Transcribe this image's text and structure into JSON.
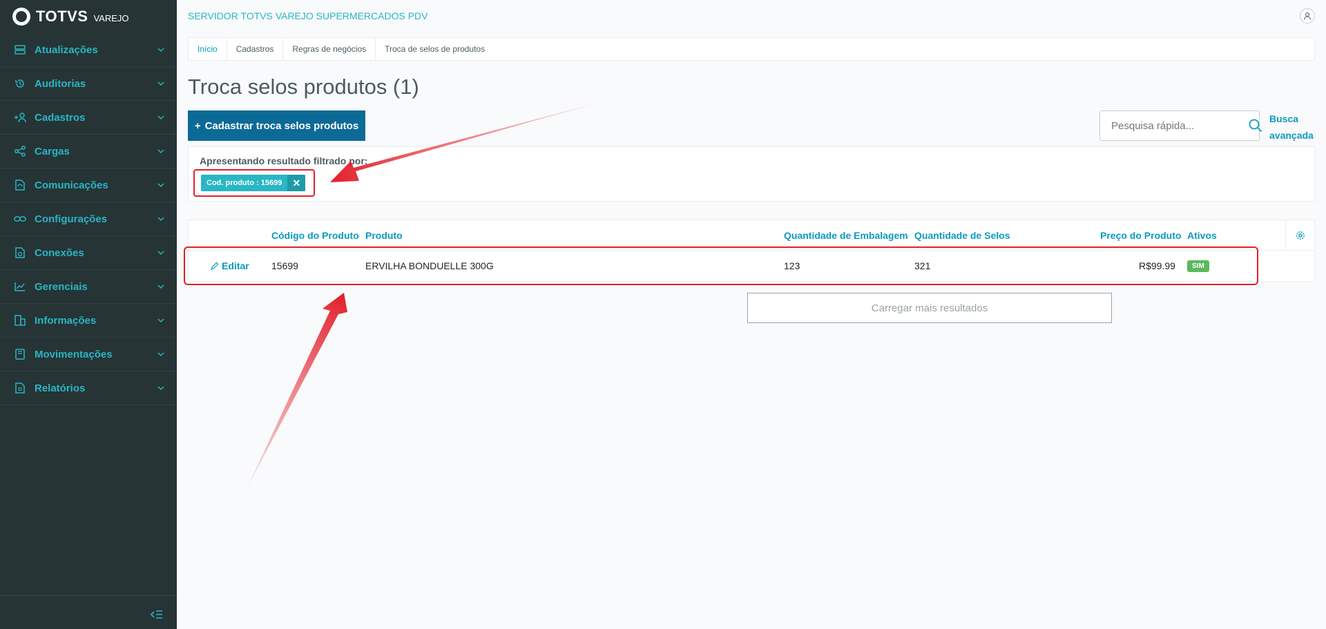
{
  "sidebar": {
    "logo": {
      "name": "TOTVS",
      "sub": "VAREJO"
    },
    "items": [
      {
        "label": "Atualizações",
        "icon": "server-icon"
      },
      {
        "label": "Auditorias",
        "icon": "history-icon"
      },
      {
        "label": "Cadastros",
        "icon": "add-user-icon"
      },
      {
        "label": "Cargas",
        "icon": "share-icon"
      },
      {
        "label": "Comunicações",
        "icon": "document-sync-icon"
      },
      {
        "label": "Configurações",
        "icon": "link-icon"
      },
      {
        "label": "Conexões",
        "icon": "document-refresh-icon"
      },
      {
        "label": "Gerenciais",
        "icon": "chart-icon"
      },
      {
        "label": "Informações",
        "icon": "building-icon"
      },
      {
        "label": "Movimentações",
        "icon": "book-icon"
      },
      {
        "label": "Relatórios",
        "icon": "report-icon"
      }
    ]
  },
  "header": {
    "server": "SERVIDOR TOTVS VAREJO SUPERMERCADOS PDV"
  },
  "breadcrumb": [
    "Início",
    "Cadastros",
    "Regras de negócios",
    "Troca de selos de produtos"
  ],
  "page": {
    "title": "Troca selos produtos (1)",
    "add_button": "Cadastrar troca selos produtos",
    "add_symbol": "+",
    "search_placeholder": "Pesquisa rápida...",
    "advanced_search": "Busca avançada",
    "filter_label": "Apresentando resultado filtrado por:",
    "filter_chip": "Cod. produto : 15699",
    "load_more": "Carregar mais resultados"
  },
  "table": {
    "columns": [
      "Código do Produto",
      "Produto",
      "Quantidade de Embalagem",
      "Quantidade de Selos",
      "Preço do Produto",
      "Ativos"
    ],
    "rows": [
      {
        "action": "Editar",
        "code": "15699",
        "product": "ERVILHA BONDUELLE 300G",
        "pack_qty": "123",
        "seal_qty": "321",
        "price": "R$99.99",
        "active": "SIM"
      }
    ]
  },
  "colors": {
    "sidebar": "#263436",
    "accent": "#29b6c5",
    "primary": "#0c6a97",
    "success": "#5cb85c",
    "annotation": "#e2202b"
  }
}
